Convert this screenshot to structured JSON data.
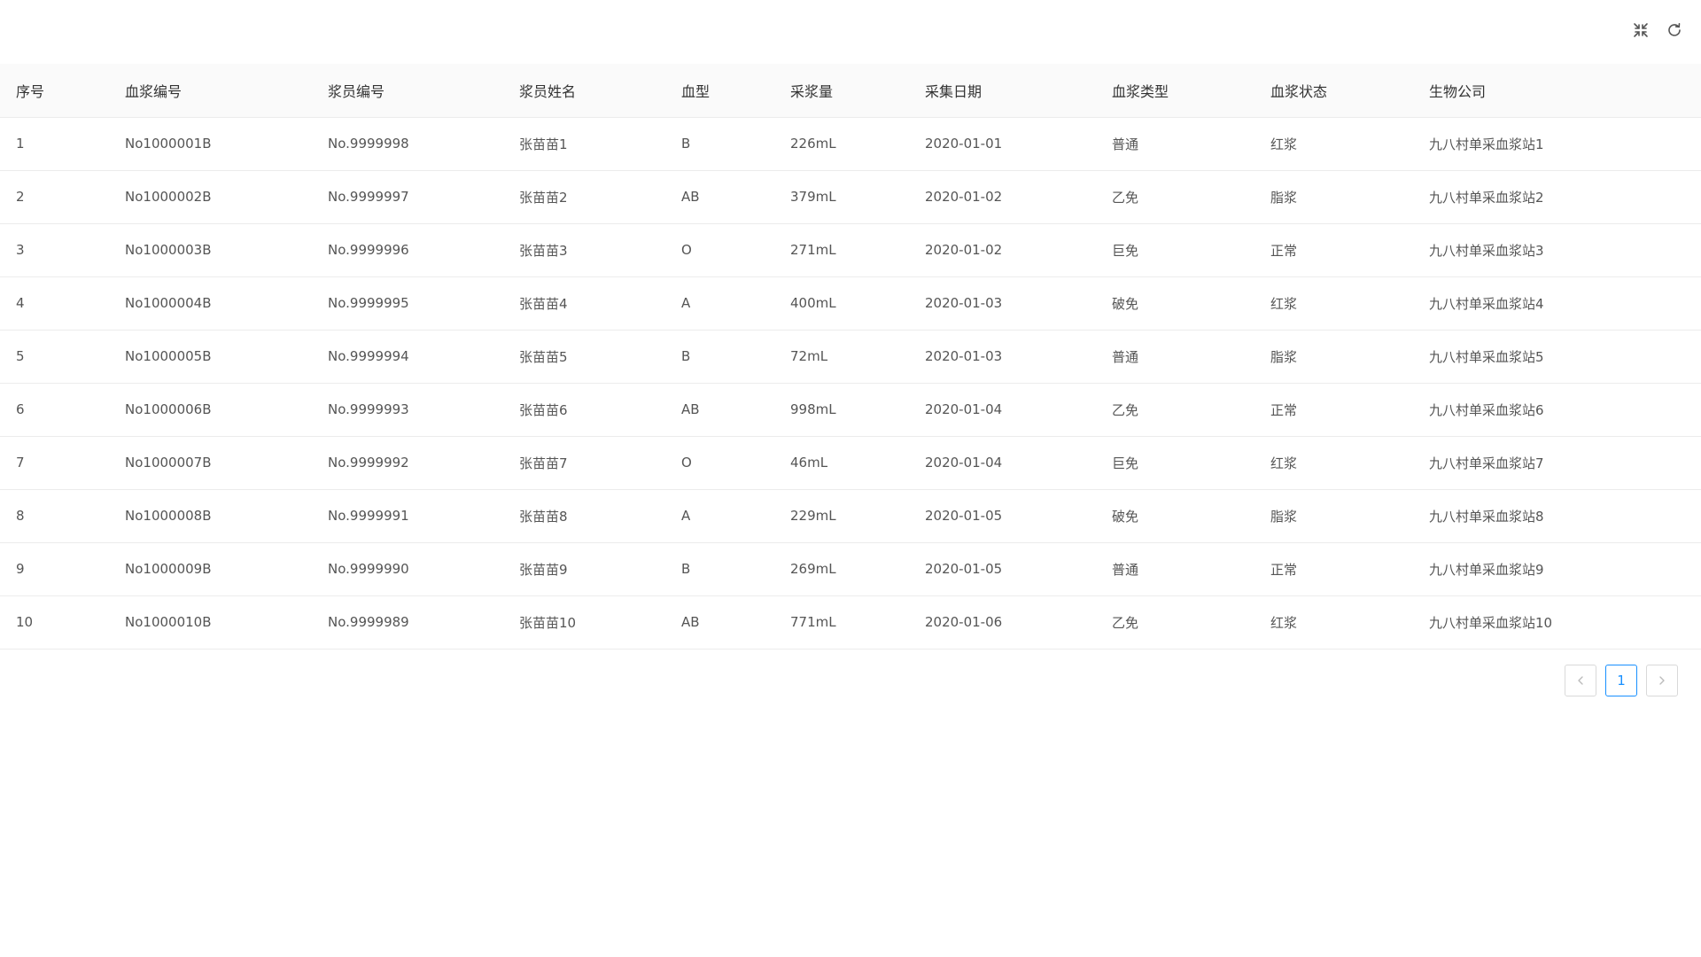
{
  "toolbar": {
    "fullscreen_icon": "compress-icon",
    "refresh_icon": "refresh-icon"
  },
  "table": {
    "columns": [
      "序号",
      "血浆编号",
      "浆员编号",
      "浆员姓名",
      "血型",
      "采浆量",
      "采集日期",
      "血浆类型",
      "血浆状态",
      "生物公司"
    ],
    "rows": [
      [
        "1",
        "No1000001B",
        "No.9999998",
        "张苗苗1",
        "B",
        "226mL",
        "2020-01-01",
        "普通",
        "红浆",
        "九八村单采血浆站1"
      ],
      [
        "2",
        "No1000002B",
        "No.9999997",
        "张苗苗2",
        "AB",
        "379mL",
        "2020-01-02",
        "乙免",
        "脂浆",
        "九八村单采血浆站2"
      ],
      [
        "3",
        "No1000003B",
        "No.9999996",
        "张苗苗3",
        "O",
        "271mL",
        "2020-01-02",
        "巨免",
        "正常",
        "九八村单采血浆站3"
      ],
      [
        "4",
        "No1000004B",
        "No.9999995",
        "张苗苗4",
        "A",
        "400mL",
        "2020-01-03",
        "破免",
        "红浆",
        "九八村单采血浆站4"
      ],
      [
        "5",
        "No1000005B",
        "No.9999994",
        "张苗苗5",
        "B",
        "72mL",
        "2020-01-03",
        "普通",
        "脂浆",
        "九八村单采血浆站5"
      ],
      [
        "6",
        "No1000006B",
        "No.9999993",
        "张苗苗6",
        "AB",
        "998mL",
        "2020-01-04",
        "乙免",
        "正常",
        "九八村单采血浆站6"
      ],
      [
        "7",
        "No1000007B",
        "No.9999992",
        "张苗苗7",
        "O",
        "46mL",
        "2020-01-04",
        "巨免",
        "红浆",
        "九八村单采血浆站7"
      ],
      [
        "8",
        "No1000008B",
        "No.9999991",
        "张苗苗8",
        "A",
        "229mL",
        "2020-01-05",
        "破免",
        "脂浆",
        "九八村单采血浆站8"
      ],
      [
        "9",
        "No1000009B",
        "No.9999990",
        "张苗苗9",
        "B",
        "269mL",
        "2020-01-05",
        "普通",
        "正常",
        "九八村单采血浆站9"
      ],
      [
        "10",
        "No1000010B",
        "No.9999989",
        "张苗苗10",
        "AB",
        "771mL",
        "2020-01-06",
        "乙免",
        "红浆",
        "九八村单采血浆站10"
      ]
    ]
  },
  "pagination": {
    "prev_icon": "chevron-left-icon",
    "current_page": "1",
    "next_icon": "chevron-right-icon",
    "active_color": "#1890ff"
  }
}
